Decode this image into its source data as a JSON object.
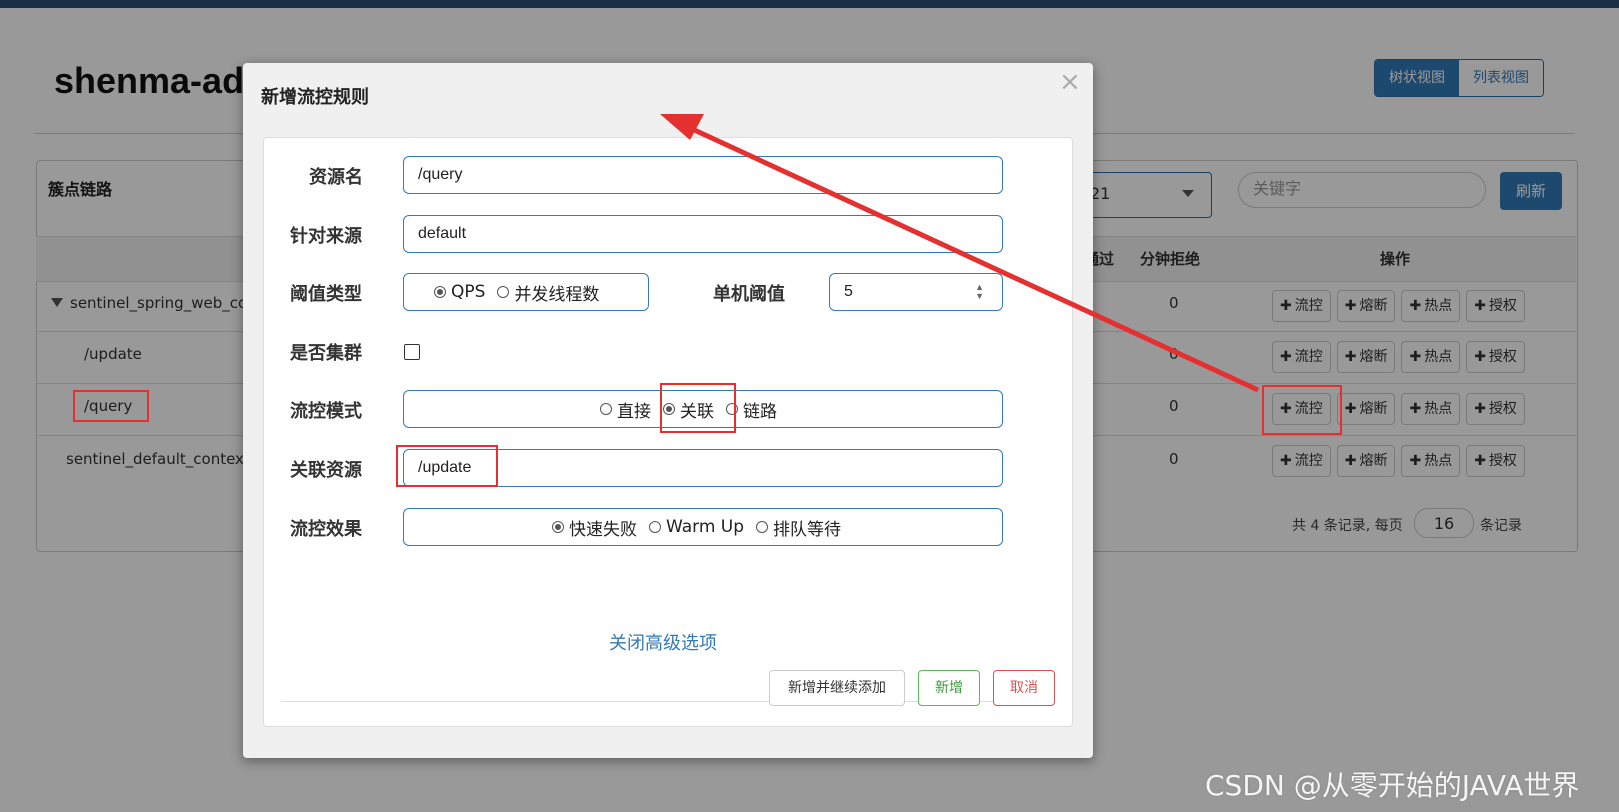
{
  "background": {
    "page_title": "shenma-ad",
    "view_toggle": {
      "tree": "树状视图",
      "list": "列表视图"
    },
    "panel_title": "簇点链路",
    "select_value": "21",
    "keyword_placeholder": "关键字",
    "refresh_label": "刷新",
    "columns": {
      "pass": "通过",
      "block": "分钟拒绝",
      "ops": "操作"
    },
    "rows": [
      {
        "name": "sentinel_spring_web_cont",
        "block": "0"
      },
      {
        "name": "/update",
        "block": "0"
      },
      {
        "name": "/query",
        "block": "0"
      },
      {
        "name": "sentinel_default_context",
        "block": "0"
      }
    ],
    "op_buttons": {
      "flow": "流控",
      "degrade": "熔断",
      "hot": "热点",
      "auth": "授权",
      "plus": "✚"
    },
    "pager": {
      "prefix": "共 4 条记录, 每页",
      "page_size": "16",
      "suffix": "条记录"
    }
  },
  "modal": {
    "title": "新增流控规则",
    "close": "×",
    "fields": {
      "resource": {
        "label": "资源名",
        "value": "/query"
      },
      "origin": {
        "label": "针对来源",
        "value": "default"
      },
      "grade": {
        "label": "阈值类型",
        "options": [
          "QPS",
          "并发线程数"
        ],
        "selected": "QPS"
      },
      "threshold": {
        "label": "单机阈值",
        "value": "5"
      },
      "cluster": {
        "label": "是否集群"
      },
      "strategy": {
        "label": "流控模式",
        "options": [
          "直接",
          "关联",
          "链路"
        ],
        "selected": "关联"
      },
      "ref_resource": {
        "label": "关联资源",
        "value": "/update"
      },
      "behavior": {
        "label": "流控效果",
        "options": [
          "快速失败",
          "Warm Up",
          "排队等待"
        ],
        "selected": "快速失败"
      }
    },
    "advanced_link": "关闭高级选项",
    "buttons": {
      "add_continue": "新增并继续添加",
      "add": "新增",
      "cancel": "取消"
    }
  },
  "watermark": "CSDN @从零开始的JAVA世界",
  "annotation_color": "#e53030"
}
